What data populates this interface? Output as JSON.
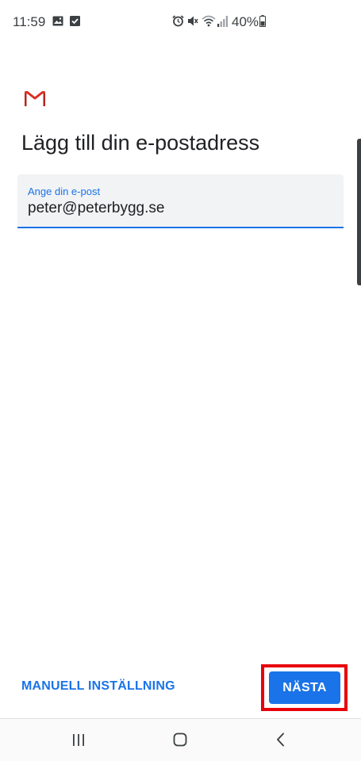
{
  "status_bar": {
    "time": "11:59",
    "battery_percent": "40%",
    "icons": [
      "image-icon",
      "checkbox-icon",
      "alarm-icon",
      "mute-icon",
      "wifi-icon",
      "signal-icon",
      "battery-icon"
    ]
  },
  "app": {
    "logo": "gmail-logo",
    "title": "Lägg till din e-postadress"
  },
  "email_field": {
    "label": "Ange din e-post",
    "value": "peter@peterbygg.se"
  },
  "actions": {
    "manual_label": "MANUELL INSTÄLLNING",
    "next_label": "NÄSTA"
  },
  "nav_bar": {
    "buttons": [
      "recents-icon",
      "home-icon",
      "back-icon"
    ]
  },
  "colors": {
    "accent": "#1a73e8",
    "highlight": "#e8000b",
    "gmail_red": "#d93025"
  }
}
